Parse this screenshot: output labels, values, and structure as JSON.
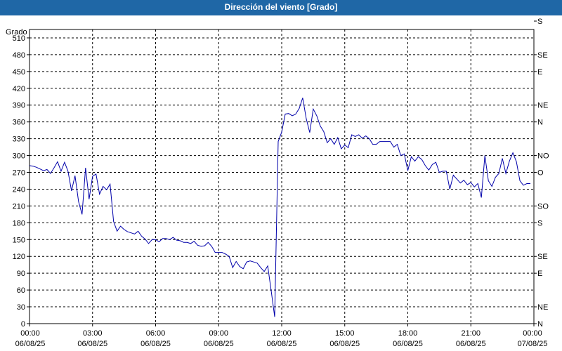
{
  "chart_data": {
    "type": "line",
    "title": "Dirección del viento [Grado]",
    "ylabel": "Grado",
    "ylim": [
      0,
      525
    ],
    "yticks": [
      0,
      30,
      60,
      90,
      120,
      150,
      180,
      210,
      240,
      270,
      300,
      330,
      360,
      390,
      420,
      450,
      480,
      510
    ],
    "xlim": [
      "06/08/25 00:00",
      "07/08/25 00:00"
    ],
    "xticks": [
      {
        "time": "00:00",
        "date": "06/08/25"
      },
      {
        "time": "03:00",
        "date": "06/08/25"
      },
      {
        "time": "06:00",
        "date": "06/08/25"
      },
      {
        "time": "09:00",
        "date": "06/08/25"
      },
      {
        "time": "12:00",
        "date": "06/08/25"
      },
      {
        "time": "15:00",
        "date": "06/08/25"
      },
      {
        "time": "18:00",
        "date": "06/08/25"
      },
      {
        "time": "21:00",
        "date": "06/08/25"
      },
      {
        "time": "00:00",
        "date": "07/08/25"
      }
    ],
    "right_axis_labels": [
      {
        "value": 0,
        "label": "N"
      },
      {
        "value": 30,
        "label": "NE"
      },
      {
        "value": 90,
        "label": "E"
      },
      {
        "value": 120,
        "label": "SE"
      },
      {
        "value": 180,
        "label": "S"
      },
      {
        "value": 210,
        "label": "SO"
      },
      {
        "value": 270,
        "label": "O"
      },
      {
        "value": 300,
        "label": "NO"
      },
      {
        "value": 360,
        "label": "N"
      },
      {
        "value": 390,
        "label": "NE"
      },
      {
        "value": 450,
        "label": "E"
      },
      {
        "value": 480,
        "label": "SE"
      },
      {
        "value": 540,
        "label": "S"
      }
    ],
    "grid": true,
    "colors": {
      "title_bar": "#1f67a6",
      "line": "#0000aa",
      "grid": "#000000"
    },
    "series": [
      {
        "x": [
          "00:00",
          "00:10",
          "00:20",
          "00:30",
          "00:40",
          "00:50",
          "01:00",
          "01:10",
          "01:20",
          "01:30",
          "01:40",
          "01:50",
          "02:00",
          "02:10",
          "02:20",
          "02:30",
          "02:40",
          "02:50",
          "03:00",
          "03:10",
          "03:20",
          "03:30",
          "03:40",
          "03:50",
          "04:00",
          "04:10",
          "04:20",
          "04:30",
          "04:40",
          "04:50",
          "05:00",
          "05:10",
          "05:20",
          "05:30",
          "05:40",
          "05:50",
          "06:00",
          "06:10",
          "06:20",
          "06:30",
          "06:40",
          "06:50",
          "07:00",
          "07:10",
          "07:20",
          "07:30",
          "07:40",
          "07:50",
          "08:00",
          "08:10",
          "08:20",
          "08:30",
          "08:40",
          "08:50",
          "09:00",
          "09:10",
          "09:20",
          "09:30",
          "09:40",
          "09:50",
          "10:00",
          "10:10",
          "10:20",
          "10:30",
          "10:40",
          "10:50",
          "11:00",
          "11:10",
          "11:20",
          "11:30",
          "11:40",
          "11:50",
          "12:00",
          "12:10",
          "12:20",
          "12:30",
          "12:40",
          "12:50",
          "13:00",
          "13:10",
          "13:20",
          "13:30",
          "13:40",
          "13:50",
          "14:00",
          "14:10",
          "14:20",
          "14:30",
          "14:40",
          "14:50",
          "15:00",
          "15:10",
          "15:20",
          "15:30",
          "15:40",
          "15:50",
          "16:00",
          "16:10",
          "16:20",
          "16:30",
          "16:40",
          "16:50",
          "17:00",
          "17:10",
          "17:20",
          "17:30",
          "17:40",
          "17:50",
          "18:00",
          "18:10",
          "18:20",
          "18:30",
          "18:40",
          "18:50",
          "19:00",
          "19:10",
          "19:20",
          "19:30",
          "19:40",
          "19:50",
          "20:00",
          "20:10",
          "20:20",
          "20:30",
          "20:40",
          "20:50",
          "21:00",
          "21:10",
          "21:20",
          "21:30",
          "21:40",
          "21:50",
          "22:00",
          "22:10",
          "22:20",
          "22:30",
          "22:40",
          "22:50",
          "23:00",
          "23:10",
          "23:20",
          "23:30",
          "23:40",
          "23:50"
        ],
        "values": [
          282,
          281,
          279,
          276,
          273,
          275,
          268,
          278,
          289,
          272,
          288,
          272,
          237,
          264,
          218,
          195,
          278,
          222,
          263,
          267,
          231,
          245,
          239,
          249,
          182,
          165,
          174,
          168,
          164,
          162,
          160,
          165,
          156,
          151,
          143,
          150,
          150,
          146,
          152,
          152,
          150,
          154,
          149,
          148,
          145,
          145,
          143,
          147,
          140,
          138,
          139,
          145,
          138,
          127,
          127,
          127,
          124,
          120,
          100,
          111,
          102,
          98,
          110,
          112,
          110,
          108,
          100,
          93,
          103,
          59,
          12,
          325,
          342,
          374,
          375,
          371,
          374,
          384,
          403,
          366,
          341,
          383,
          371,
          353,
          343,
          323,
          330,
          320,
          332,
          312,
          319,
          314,
          337,
          334,
          337,
          331,
          335,
          330,
          320,
          320,
          325,
          325,
          325,
          325,
          315,
          320,
          300,
          303,
          273,
          298,
          290,
          298,
          293,
          282,
          274,
          284,
          288,
          270,
          272,
          272,
          240,
          265,
          258,
          251,
          256,
          248,
          252,
          244,
          250,
          225,
          300,
          255,
          245,
          261,
          268,
          295,
          268,
          290,
          305,
          289,
          255,
          247,
          250,
          250
        ]
      }
    ]
  }
}
